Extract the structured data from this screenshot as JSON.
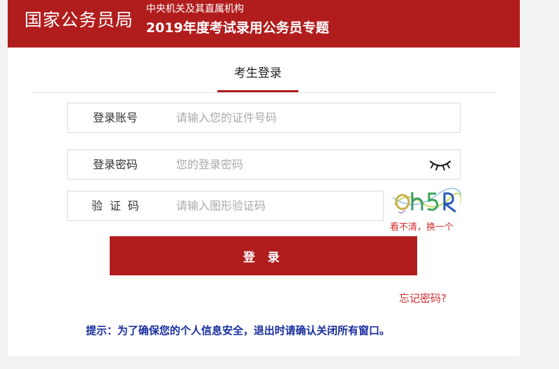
{
  "header": {
    "brand": "国家公务员局",
    "subtitle_top": "中央机关及其直属机构",
    "subtitle_main": "2019年度考试录用公务员专题"
  },
  "tab": {
    "label": "考生登录"
  },
  "form": {
    "account": {
      "label": "登录账号",
      "placeholder": "请输入您的证件号码"
    },
    "password": {
      "label": "登录密码",
      "placeholder": "您的登录密码"
    },
    "captcha": {
      "label": "验证码",
      "placeholder": "请输入图形验证码",
      "refresh_text": "看不清，换一个"
    },
    "login_button": "登 录",
    "forgot_link": "忘记密码?"
  },
  "tip": "提示：为了确保您的个人信息安全，退出时请确认关闭所有窗口。",
  "colors": {
    "brand_red": "#b11d1d",
    "link_red": "#d22b2b",
    "tip_blue": "#1a2f9e"
  },
  "icons": {
    "password_toggle": "closed-eye-icon",
    "captcha": "captcha-image"
  }
}
